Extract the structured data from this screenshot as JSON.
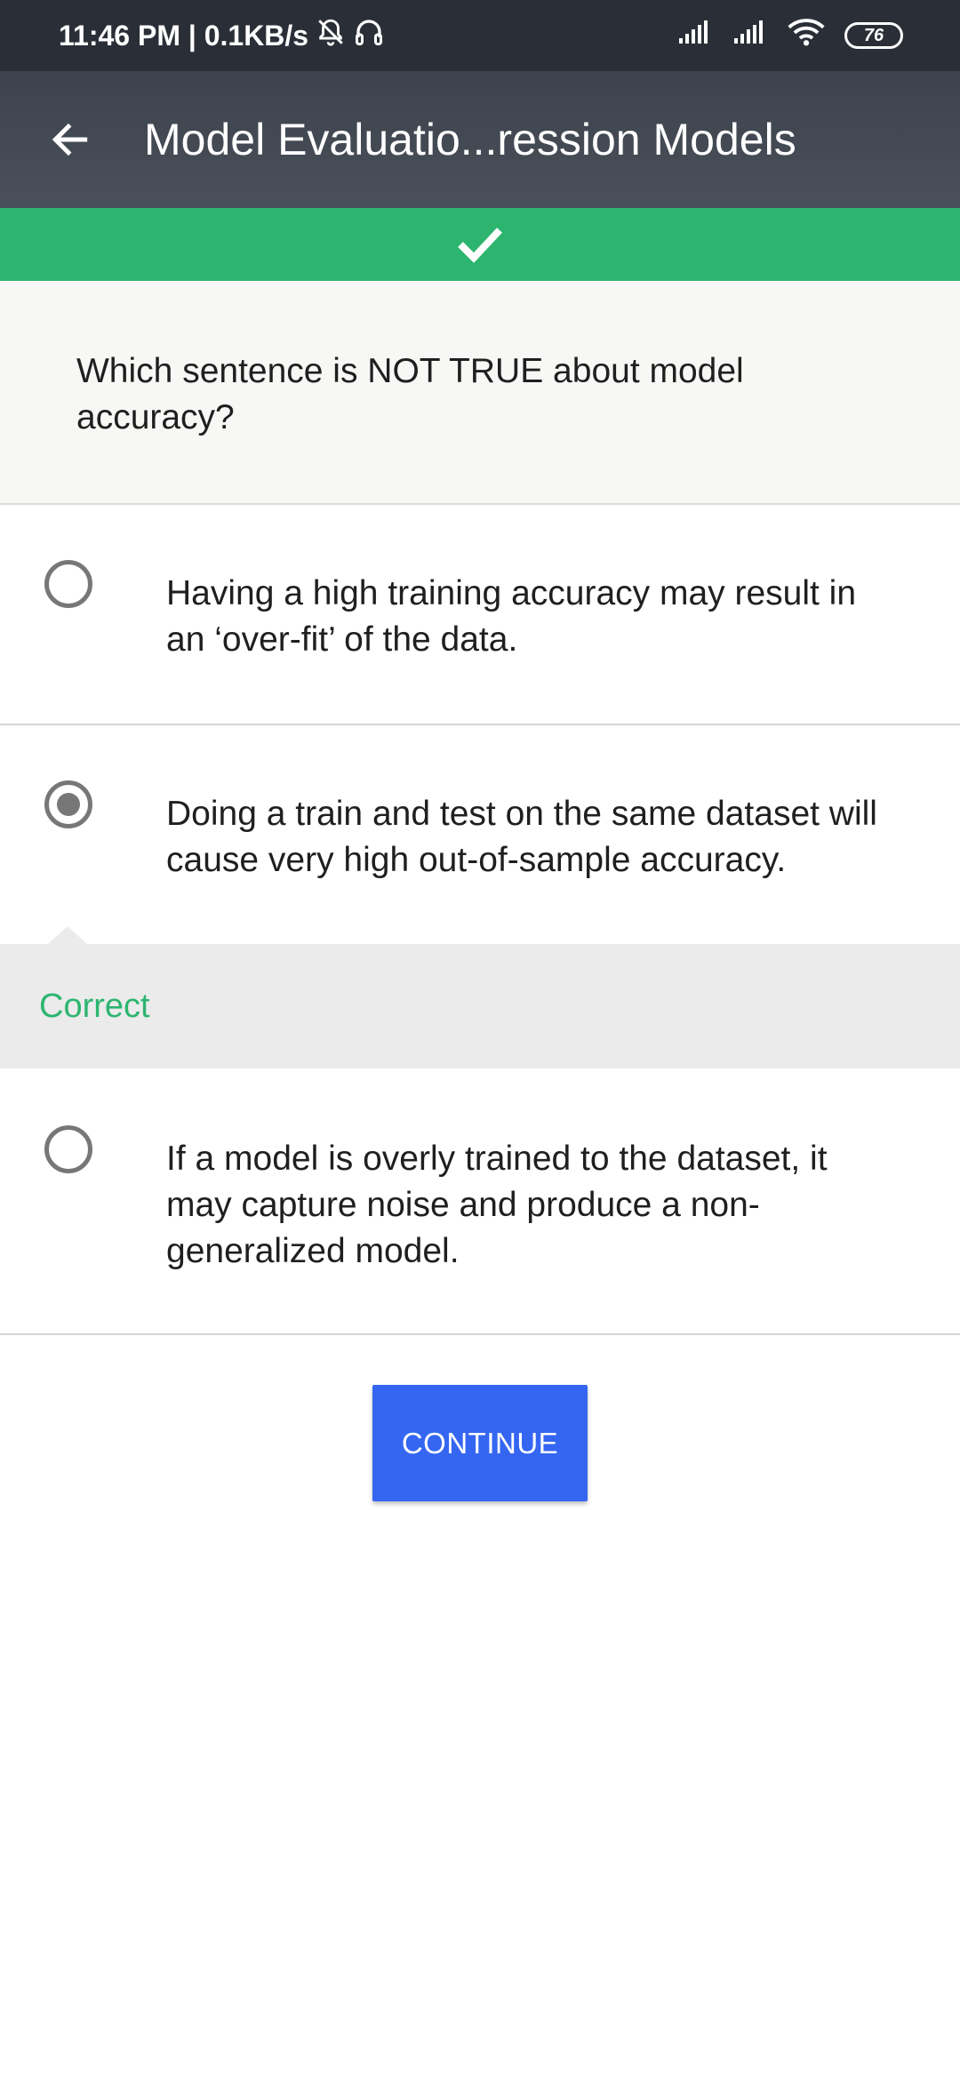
{
  "status_bar": {
    "time_speed": "11:46 PM | 0.1KB/s",
    "battery": "76",
    "icons": [
      "alarm-off-icon",
      "headset-icon",
      "signal-icon",
      "signal-icon",
      "wifi-icon",
      "battery-icon"
    ]
  },
  "app_bar": {
    "title": "Model Evaluatio...ression Models",
    "back_icon": "arrow-back-icon"
  },
  "result_banner": {
    "icon": "checkmark-icon",
    "color": "#2db570"
  },
  "quiz": {
    "question": "Which sentence is NOT TRUE about model accuracy?",
    "options": [
      {
        "text": "Having a high training accuracy may result in an ‘over-fit’ of the data.",
        "selected": false
      },
      {
        "text": "Doing a train and test on the same dataset will cause very high out-of-sample accuracy.",
        "selected": true
      },
      {
        "text": "If a model is overly trained to the dataset, it may capture noise and produce a non-generalized model.",
        "selected": false
      }
    ],
    "feedback": "Correct"
  },
  "continue_label": "CONTINUE",
  "colors": {
    "accent_green": "#2db570",
    "button_blue": "#3466f2",
    "app_bar": "#454b55",
    "status_bar": "#2a2f37"
  }
}
